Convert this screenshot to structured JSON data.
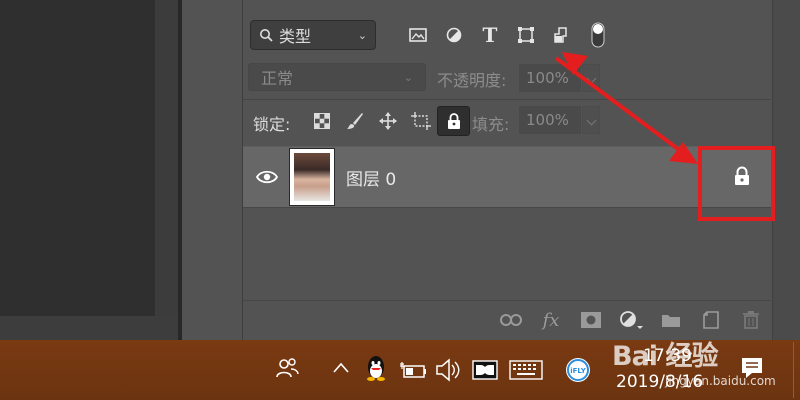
{
  "layers_panel": {
    "filter": {
      "label": "类型",
      "icon": "search-icon"
    },
    "filter_icons": [
      "image-filter-icon",
      "adjustment-filter-icon",
      "type-filter-icon",
      "shape-filter-icon",
      "smart-object-filter-icon",
      "filter-toggle-icon"
    ],
    "filter_type_glyph": "T",
    "blend_mode": "正常",
    "opacity_label": "不透明度:",
    "opacity_value": "100%",
    "lock_label": "锁定:",
    "lock_icons": [
      "lock-transparent-icon",
      "lock-image-icon",
      "lock-position-icon",
      "lock-artboard-icon",
      "lock-all-icon"
    ],
    "fill_label": "填充:",
    "fill_value": "100%",
    "layer": {
      "name": "图层 0",
      "locked": true
    },
    "bottom_icons": [
      "link-icon",
      "fx-icon",
      "mask-icon",
      "adjustment-icon",
      "group-icon",
      "new-layer-icon",
      "delete-icon"
    ],
    "fx_label": "fx"
  },
  "taskbar": {
    "time": "17:39",
    "date": "2019/8/16",
    "ifly_label": "iFLY",
    "tray_icons": [
      "people-icon",
      "chevron-up-icon",
      "qq-icon",
      "battery-icon",
      "speaker-icon",
      "dolby-icon",
      "keyboard-icon",
      "ifly-icon"
    ],
    "notification_icon": "notification-icon"
  },
  "watermark": {
    "text": "Bai 经验",
    "sub": "jingyan.baidu.com"
  },
  "colors": {
    "annotation_red": "#e41e1e",
    "panel_bg": "#535353",
    "taskbar": "#6e3612"
  }
}
